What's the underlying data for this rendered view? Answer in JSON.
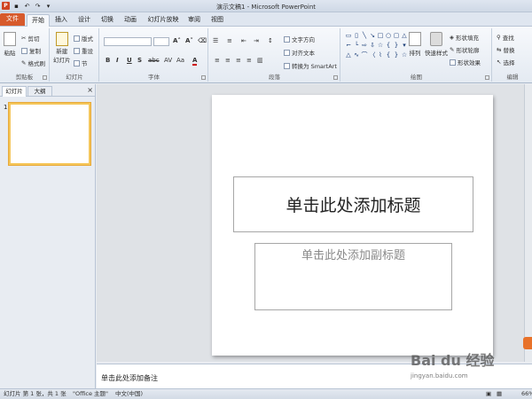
{
  "window": {
    "title": "演示文稿1 - Microsoft PowerPoint"
  },
  "tabs": [
    "文件",
    "开始",
    "插入",
    "设计",
    "切换",
    "动画",
    "幻灯片放映",
    "审阅",
    "视图"
  ],
  "ribbon": {
    "clipboard": {
      "paste": "粘贴",
      "cut": "剪切",
      "copy": "复制",
      "format_painter": "格式刷",
      "label": "剪贴板"
    },
    "slides": {
      "new_slide_line1": "新建",
      "new_slide_line2": "幻灯片",
      "layout": "版式",
      "reset": "重设",
      "section": "节",
      "label": "幻灯片"
    },
    "font": {
      "grow": "A˄",
      "shrink": "A˅",
      "bold": "B",
      "italic": "I",
      "underline": "U",
      "strike": "S",
      "abc": "abc",
      "spacing": "AV",
      "case": "Aa",
      "color": "A",
      "label": "字体"
    },
    "paragraph": {
      "text_direction": "文字方向",
      "align_text": "对齐文本",
      "smartart": "转换为 SmartArt",
      "label": "段落"
    },
    "drawing": {
      "arrange": "排列",
      "quick_styles": "快速样式",
      "shape_fill": "形状填充",
      "shape_outline": "形状轮廓",
      "shape_effects": "形状效果",
      "label": "绘图"
    },
    "editing": {
      "find": "查找",
      "replace": "替换",
      "select": "选择",
      "label": "编辑"
    }
  },
  "left_pane": {
    "tab_slides": "幻灯片",
    "tab_outline": "大纲",
    "close": "×",
    "slide_number": "1"
  },
  "slide": {
    "title_placeholder": "单击此处添加标题",
    "subtitle_placeholder": "单击此处添加副标题"
  },
  "notes": {
    "placeholder": "单击此处添加备注"
  },
  "status": {
    "slide_info": "幻灯片 第 1 张，共 1 张",
    "theme": "\"Office 主题\"",
    "language": "中文(中国)",
    "zoom": "66%"
  },
  "watermark": {
    "main": "Bai du 经验",
    "sub": "jingyan.baidu.com"
  }
}
